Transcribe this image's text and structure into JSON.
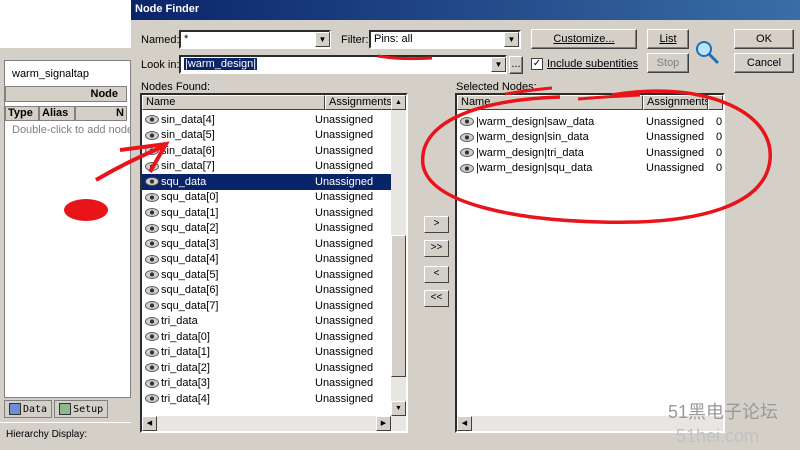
{
  "background_window": {
    "title": "warm_signaltap",
    "node_header": "Node",
    "columns": [
      "Type",
      "Alias",
      "N"
    ],
    "hint": "Double-click to add nodes",
    "tabs": [
      {
        "label": "Data"
      },
      {
        "label": "Setup"
      }
    ],
    "hierarchy_label": "Hierarchy Display:"
  },
  "dialog": {
    "title": "Node Finder",
    "named_label": "Named:",
    "named_value": "*",
    "filter_label": "Filter:",
    "filter_value": "Pins: all",
    "customize_button": "Customize...",
    "list_button": "List",
    "stop_button": "Stop",
    "ok_button": "OK",
    "cancel_button": "Cancel",
    "look_in_label": "Look in:",
    "look_in_value": "|warm_design|",
    "browse_button": "...",
    "include_subentities_label": "Include subentities",
    "include_subentities_checked": true,
    "nodes_found_label": "Nodes Found:",
    "selected_nodes_label": "Selected Nodes:",
    "col_name": "Name",
    "col_assignments": "Assignments",
    "move_buttons": [
      ">",
      ">>",
      "<",
      "<<"
    ],
    "nodes_found": [
      {
        "name": "sin_data[4]",
        "assignment": "Unassigned"
      },
      {
        "name": "sin_data[5]",
        "assignment": "Unassigned"
      },
      {
        "name": "sin_data[6]",
        "assignment": "Unassigned"
      },
      {
        "name": "sin_data[7]",
        "assignment": "Unassigned"
      },
      {
        "name": "squ_data",
        "assignment": "Unassigned",
        "selected": true
      },
      {
        "name": "squ_data[0]",
        "assignment": "Unassigned"
      },
      {
        "name": "squ_data[1]",
        "assignment": "Unassigned"
      },
      {
        "name": "squ_data[2]",
        "assignment": "Unassigned"
      },
      {
        "name": "squ_data[3]",
        "assignment": "Unassigned"
      },
      {
        "name": "squ_data[4]",
        "assignment": "Unassigned"
      },
      {
        "name": "squ_data[5]",
        "assignment": "Unassigned"
      },
      {
        "name": "squ_data[6]",
        "assignment": "Unassigned"
      },
      {
        "name": "squ_data[7]",
        "assignment": "Unassigned"
      },
      {
        "name": "tri_data",
        "assignment": "Unassigned"
      },
      {
        "name": "tri_data[0]",
        "assignment": "Unassigned"
      },
      {
        "name": "tri_data[1]",
        "assignment": "Unassigned"
      },
      {
        "name": "tri_data[2]",
        "assignment": "Unassigned"
      },
      {
        "name": "tri_data[3]",
        "assignment": "Unassigned"
      },
      {
        "name": "tri_data[4]",
        "assignment": "Unassigned"
      }
    ],
    "selected_nodes": [
      {
        "name": "|warm_design|saw_data",
        "assignment": "Unassigned",
        "extra": "0"
      },
      {
        "name": "|warm_design|sin_data",
        "assignment": "Unassigned",
        "extra": "0"
      },
      {
        "name": "|warm_design|tri_data",
        "assignment": "Unassigned",
        "extra": "0"
      },
      {
        "name": "|warm_design|squ_data",
        "assignment": "Unassigned",
        "extra": "0"
      }
    ]
  },
  "watermark": {
    "line1": "51黑电子论坛",
    "line2": "51hei.com"
  },
  "colors": {
    "annotation": "#e8141a",
    "selection": "#0a246a",
    "face": "#d4d0c8"
  }
}
